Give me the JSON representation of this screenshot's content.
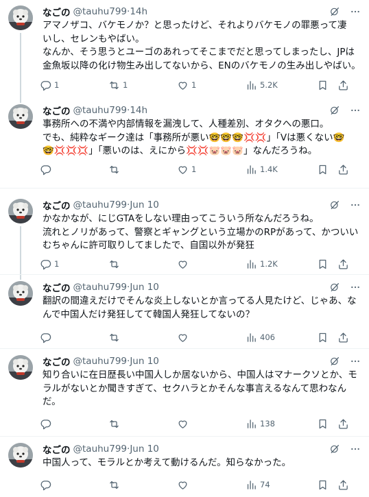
{
  "tweets": [
    {
      "name": "なごの",
      "handle": "@tauhu799",
      "time": "14h",
      "lines": [
        "アマノザコ、バケモノか？と思ったけど、それよりバケモノの罪悪って凄",
        "いし、セレンもやばい。",
        "なんか、そう思うとユーゴのあれってそこまでだと思ってしまったし、JPは",
        "金魚坂以降の化け物生み出してないから、ENのバケモノの生み出しやばい。"
      ],
      "replies": "1",
      "retweets": "1",
      "likes": "1",
      "views": "5.2K"
    },
    {
      "name": "なごの",
      "handle": "@tauhu799",
      "time": "14h",
      "lines": [
        "事務所への不満や内部情報を漏洩して、人種差別、オタクへの悪口。",
        "でも、純粋なギーク達は「事務所が悪い🤓🤓🤓💢💢」「Vは悪くない🤓",
        "🤓💢💢💢」「悪いのは、えにから💢💢🐷🐷🐷」なんだろうね。"
      ],
      "replies": "",
      "retweets": "",
      "likes": "1",
      "views": "1.4K"
    },
    {
      "name": "なごの",
      "handle": "@tauhu799",
      "time": "Jun 10",
      "lines": [
        "かなかなが、にじGTAをしない理由ってこういう所なんだろうね。",
        "流れとノリがあって、警察とギャングという立場かのRPがあって、かついい",
        "むちゃんに許可取りしてましたで、自国以外が発狂"
      ],
      "replies": "1",
      "retweets": "",
      "likes": "",
      "views": "1.2K"
    },
    {
      "name": "なごの",
      "handle": "@tauhu799",
      "time": "Jun 10",
      "lines": [
        "翻訳の間違えだけでそんな炎上しないとか言ってる人見たけど、じゃあ、な",
        "んで中国人だけ発狂してて韓国人発狂してないの？"
      ],
      "replies": "",
      "retweets": "",
      "likes": "",
      "views": "406"
    },
    {
      "name": "なごの",
      "handle": "@tauhu799",
      "time": "Jun 10",
      "lines": [
        "知り合いに在日歴長い中国人しか居ないから、中国人はマナークソとか、モ",
        "ラルがないとか聞きすぎて、セクハラとかそんな事言えるなんて思わなん",
        "だ。"
      ],
      "replies": "",
      "retweets": "",
      "likes": "",
      "views": "138"
    },
    {
      "name": "なごの",
      "handle": "@tauhu799",
      "time": "Jun 10",
      "lines": [
        "中国人って、モラルとか考えて動けるんだ。知らなかった。"
      ],
      "replies": "",
      "retweets": "",
      "likes": "",
      "views": "74"
    }
  ],
  "separator": " · ",
  "colors": {
    "text": "#0f1419",
    "muted": "#536471",
    "line": "#cfd9de",
    "divider": "#eff3f4"
  },
  "icons": [
    "grok-icon",
    "more-icon",
    "reply-icon",
    "retweet-icon",
    "like-icon",
    "views-icon",
    "bookmark-icon",
    "share-icon"
  ]
}
